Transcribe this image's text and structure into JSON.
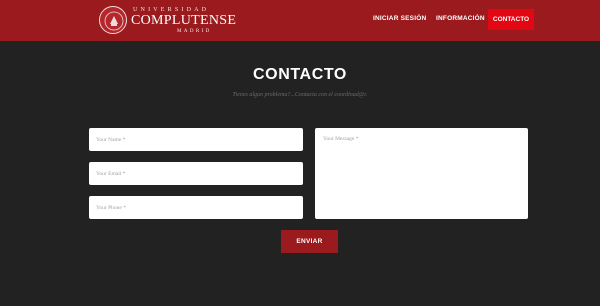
{
  "brand": {
    "line1": "UNIVERSIDAD",
    "line2": "COMPLUTENSE",
    "line3": "MADRID"
  },
  "nav": {
    "login": "INICIAR SESIÓN",
    "info": "INFORMACIÓN",
    "contact": "CONTACTO"
  },
  "page": {
    "title": "CONTACTO",
    "subtitle": "Tienes algun problema?...Contacta con el coordinad@r."
  },
  "form": {
    "name_placeholder": "Your Name *",
    "email_placeholder": "Your Email *",
    "phone_placeholder": "Your Phone *",
    "message_placeholder": "Your Message *",
    "submit_label": "ENVIAR"
  },
  "colors": {
    "header_bg": "#9b1a1e",
    "active_nav_bg": "#e30613",
    "page_bg": "#222222",
    "button_bg": "#9b1a1e"
  }
}
